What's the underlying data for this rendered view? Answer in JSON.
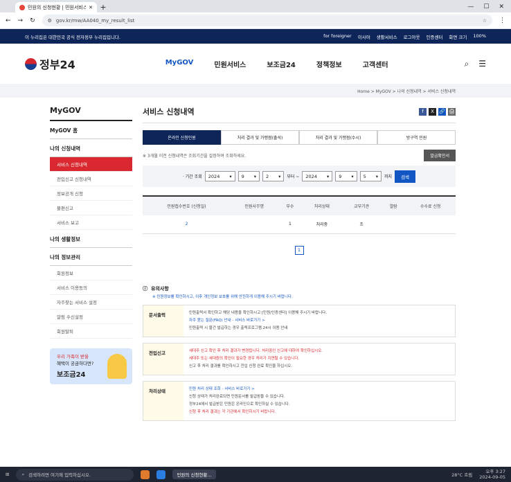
{
  "browser": {
    "tab_title": "민원의 신청현황 | 민원서비스 | 정",
    "new_tab": "+",
    "url": "gov.kr/mw/AA040_my_result_list",
    "win_min": "—",
    "win_max": "☐",
    "win_close": "✕"
  },
  "topbar": {
    "notice": "이 누리집은 대한민국 공식 전자정부 누리집입니다.",
    "lang": "for foreigner",
    "links": [
      "이사야",
      "생활서비스",
      "로그아웃",
      "인증센터",
      "화면 크기",
      "100%"
    ]
  },
  "header": {
    "logo_text": "정부24",
    "nav": [
      "MyGOV",
      "민원서비스",
      "보조금24",
      "정책정보",
      "고객센터"
    ]
  },
  "breadcrumb": "Home > MyGOV > 나의 신청내역 > 서비스 신청내역",
  "sidebar": {
    "title": "MyGOV",
    "home": "MyGOV 홈",
    "group1": "나의 신청내역",
    "group1_items": [
      "서비스 신청내역",
      "전입신고 신청내역",
      "정보공개 신청",
      "불편신고",
      "서비스 보고"
    ],
    "group2": "나의 생활정보",
    "group3": "나의 정보관리",
    "group3_items": [
      "회원정보",
      "서비스 이용동의",
      "자주찾는 서비스 설정",
      "알림 수신설정",
      "회원탈퇴"
    ],
    "banner": {
      "line1": "우리 가족이 받을",
      "line2": "혜택이 궁금하다면?",
      "line3": "보조금24"
    }
  },
  "content": {
    "title": "서비스 신청내역",
    "share_icons": [
      "f",
      "X",
      "🔗",
      "🖨"
    ],
    "tabs": [
      "온라인 신청민원",
      "처리 결과 및 가맹점(출석)",
      "처리 결과 및 가맹점(수시)",
      "방구역 민원"
    ],
    "notice": "※ 3개월 이전 신청내역은 조회기간을 설정하여 조회하세요.",
    "notice_button": "발급확인서",
    "search": {
      "label": "· 기간 조회",
      "from_year": "2024",
      "from_month": "9",
      "from_day": "2",
      "sep": "부터 ~",
      "to_year": "2024",
      "to_month": "9",
      "to_day": "5",
      "until": "까지",
      "button": "검색"
    },
    "table": {
      "headers": [
        "민원접수번호\n(신청일)",
        "민원사무명",
        "부수",
        "처리상태",
        "교부기관",
        "열람",
        "수수료 신청"
      ],
      "rows": [
        [
          "2",
          "",
          "1",
          "처리중",
          "조",
          "",
          ""
        ]
      ]
    },
    "page": "1",
    "caution_title": "유의사항",
    "caution_note": "※ 민원정보를 확인하시고, 이후 개인정보 보호를 위해 안전하게 이용해 주시기 바랍니다.",
    "boxes": [
      {
        "label": "문서출력",
        "lines": [
          "민원출력서 확인하고 해당 내용을 확인하시고 [민원/인증센터] 이용해 주시기 바랍니다.",
          "자주 묻는 질문(FAQ) 안내 - 서비스 바로가기 >",
          "민원출력 시 물건 발급하는 경우 출력프로그램 24시 이용 안내"
        ]
      },
      {
        "label": "전입신고",
        "lines": [
          "세대주 신고 확인 후 처리 결과가 변경됩니다. 처리중인 신고에 대하여 확인하십시오.",
          "세대주 또는 세대원의 확인이 필요한 경우 처리가 지연될 수 있습니다.",
          "신고 후 처리 결과를 확인하시고 전입 신청 완료 확인을 하십시오."
        ]
      },
      {
        "label": "처리상태",
        "lines": [
          "민원 처리 상태 조회 - 서비스 바로가기 >",
          "신청 상태가 처리완료되면 민원문서를 발급받을 수 있습니다.",
          "정부24에서 발급받은 민원은 온라인으로 확인하실 수 있습니다.",
          "신청 후 처리 결과는 각 기관에서 확인하시기 바랍니다."
        ]
      }
    ]
  },
  "taskbar": {
    "search_placeholder": "검색하려면 여기에 입력하십시오.",
    "app_label": "민원의 신청현황...",
    "weather": "28°C 흐림",
    "time": "오후 3:27",
    "date": "2024-09-05"
  },
  "colors": {
    "brand_blue": "#0d2559",
    "accent_red": "#d9282f",
    "link_blue": "#1256c4"
  }
}
